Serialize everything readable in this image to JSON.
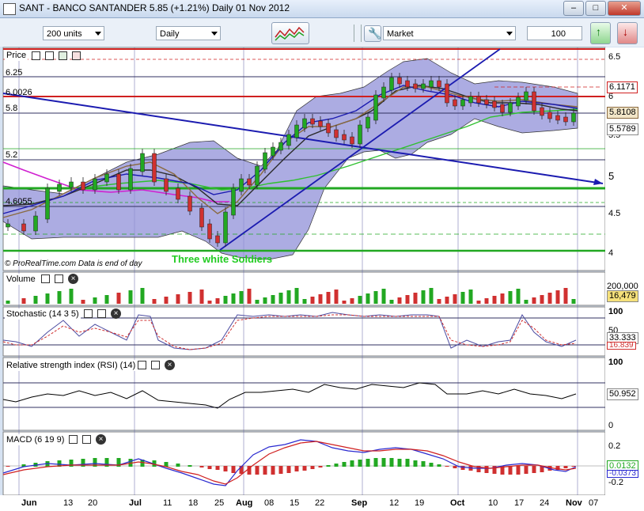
{
  "window": {
    "title": "SANT - BANCO SANTANDER     5.85 (+1.21%)    Daily  01 Nov 2012"
  },
  "toolbar": {
    "units": "200 units",
    "period": "Daily",
    "order_type": "Market",
    "quantity": "100"
  },
  "price_panel": {
    "label": "Price",
    "watermark": "© ProRealTime.com  Data is end of day",
    "annotation": "Three white Soldiers",
    "line_labels": [
      "6.25",
      "6.0026",
      "5.8",
      "5.2",
      "4.6055"
    ],
    "axis": [
      "6.5",
      "6",
      "5.5",
      "5",
      "4.5",
      "4"
    ],
    "value_boxes": [
      "6.1171",
      "5.8108",
      "5.5789"
    ]
  },
  "volume_panel": {
    "label": "Volume",
    "axis": [
      "200,000"
    ],
    "value": "16,479"
  },
  "stochastic_panel": {
    "label": "Stochastic (14 3 5)",
    "axis": [
      "100",
      "50"
    ],
    "values": [
      "33.333",
      "16.839"
    ]
  },
  "rsi_panel": {
    "label": "Relative strength index (RSI) (14)",
    "axis": [
      "100",
      "50",
      "0"
    ],
    "value": "50.952"
  },
  "macd_panel": {
    "label": "MACD (6 19 9)",
    "axis": [
      "0.2",
      "0",
      "-0.2"
    ],
    "values": [
      "0.0132",
      "-0.0373"
    ]
  },
  "x_axis": [
    "Jun",
    "13",
    "20",
    "Jul",
    "11",
    "18",
    "25",
    "Aug",
    "08",
    "15",
    "22",
    "Sep",
    "12",
    "19",
    "Oct",
    "10",
    "17",
    "24",
    "Nov",
    "07"
  ],
  "colors": {
    "up": "#22a822",
    "down": "#d03030",
    "band": "#6f6fc8",
    "trend": "#1b1bb0"
  }
}
